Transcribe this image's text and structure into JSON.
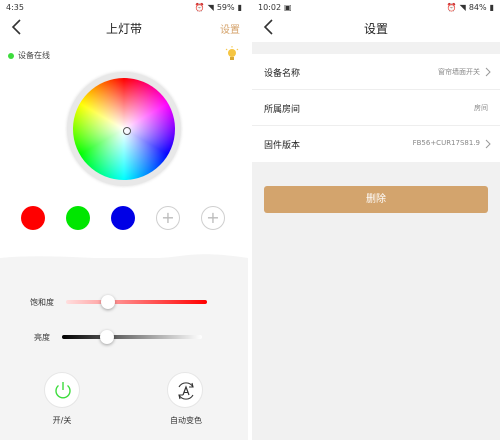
{
  "left_screen": {
    "status_bar": {
      "time": "4:35",
      "battery": "59%"
    },
    "nav": {
      "title": "上灯带",
      "action_label": "设置"
    },
    "online_label": "设备在线",
    "presets": [
      {
        "color": "#ff0000"
      },
      {
        "color": "#00e600"
      },
      {
        "color": "#0000e6"
      }
    ],
    "add_symbol": "+",
    "sliders": {
      "saturation": {
        "label": "饱和度",
        "value_fraction": 0.3
      },
      "brightness": {
        "label": "亮度",
        "value_fraction": 0.32
      }
    },
    "controls": {
      "power_label": "开/关",
      "auto_color_label": "自动变色"
    }
  },
  "right_screen": {
    "status_bar": {
      "time": "10:02",
      "battery": "84%"
    },
    "nav": {
      "title": "设置"
    },
    "rows": [
      {
        "label": "设备名称",
        "value": "窗帘墙面开关"
      },
      {
        "label": "所属房间",
        "value": "房间"
      },
      {
        "label": "固件版本",
        "value": "FB56+CUR17S81.9"
      }
    ],
    "delete_label": "删除"
  },
  "colors": {
    "accent": "#d4a26a",
    "delete_button": "#d3a46d",
    "online_dot": "#3ddc3d",
    "power_icon": "#3ddc3d"
  }
}
